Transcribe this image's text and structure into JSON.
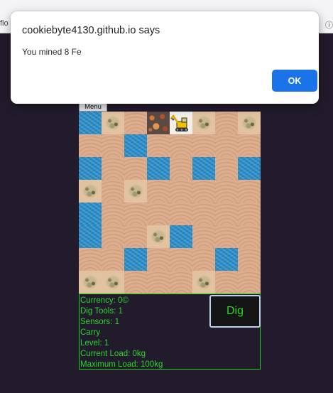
{
  "browser": {
    "tab_title": "flo",
    "tab_right": "ⓘ"
  },
  "alert": {
    "title": "cookiebyte4130.github.io says",
    "message": "You mined 8 Fe",
    "ok_label": "OK"
  },
  "game": {
    "menu_label": "Menu",
    "dig_label": "Dig",
    "map_rows": [
      [
        "water",
        "rock",
        "sand",
        "ore",
        "player",
        "rock",
        "sand",
        "rock"
      ],
      [
        "sand",
        "sand",
        "water",
        "sand",
        "sand",
        "sand",
        "sand",
        "sand"
      ],
      [
        "water",
        "sand",
        "sand",
        "water",
        "sand",
        "water",
        "sand",
        "water"
      ],
      [
        "rock",
        "sand",
        "rock",
        "sand",
        "sand",
        "sand",
        "sand",
        "sand"
      ],
      [
        "water",
        "sand",
        "sand",
        "sand",
        "sand",
        "sand",
        "sand",
        "sand"
      ],
      [
        "water",
        "sand",
        "sand",
        "rock",
        "water",
        "sand",
        "sand",
        "sand"
      ],
      [
        "sand",
        "sand",
        "water",
        "sand",
        "sand",
        "sand",
        "water",
        "sand"
      ],
      [
        "rock",
        "rock",
        "sand",
        "sand",
        "sand",
        "rock",
        "sand",
        "sand"
      ]
    ],
    "stats": {
      "currency": "Currency: 0©",
      "dig_tools": "Dig Tools: 1",
      "sensors": "Sensors: 1",
      "carry": "Carry",
      "level": "Level: 1",
      "current_load": "Current Load: 0kg",
      "maximum_load": "Maximum Load: 100kg"
    }
  },
  "colors": {
    "background": "#221b2c",
    "stats_text": "#2cd42c",
    "ok_button": "#1a73e8"
  }
}
